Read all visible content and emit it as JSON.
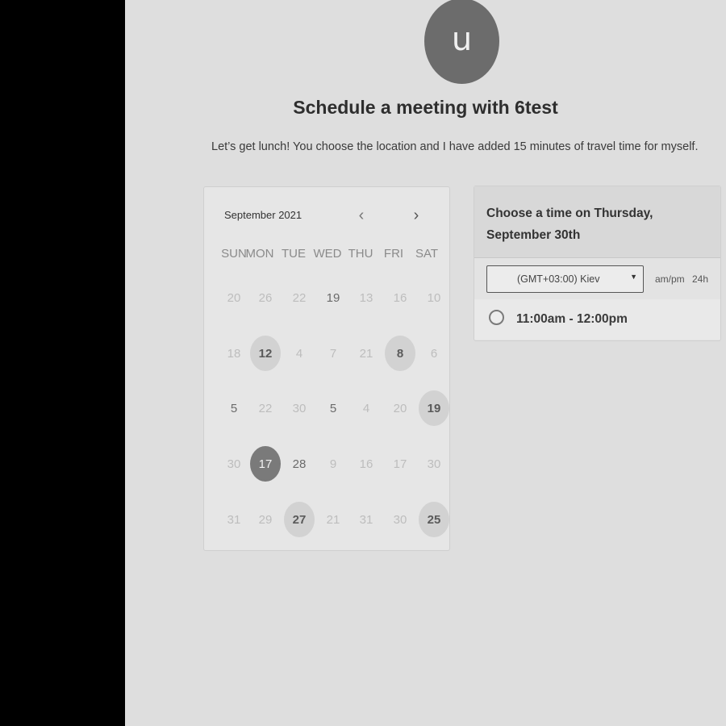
{
  "avatar": {
    "initial": "u"
  },
  "header": {
    "title": "Schedule a meeting with 6test",
    "description": "Let’s get lunch! You choose the location and I have added 15 minutes of travel time for myself."
  },
  "calendar": {
    "month_label": "September 2021",
    "prev_icon": "‹",
    "next_icon": "›",
    "weekdays": [
      "SUN",
      "MON",
      "TUE",
      "WED",
      "THU",
      "FRI",
      "SAT"
    ],
    "weeks": [
      [
        {
          "d": "20",
          "s": "muted"
        },
        {
          "d": "26",
          "s": "muted"
        },
        {
          "d": "22",
          "s": "muted"
        },
        {
          "d": "19",
          "s": "bold"
        },
        {
          "d": "13",
          "s": "muted"
        },
        {
          "d": "16",
          "s": "muted"
        },
        {
          "d": "10",
          "s": "muted"
        }
      ],
      [
        {
          "d": "18",
          "s": "muted"
        },
        {
          "d": "12",
          "s": "available"
        },
        {
          "d": "4",
          "s": "muted"
        },
        {
          "d": "7",
          "s": "muted"
        },
        {
          "d": "21",
          "s": "muted"
        },
        {
          "d": "8",
          "s": "available"
        },
        {
          "d": "6",
          "s": "muted"
        }
      ],
      [
        {
          "d": "5",
          "s": "bold"
        },
        {
          "d": "22",
          "s": "muted"
        },
        {
          "d": "30",
          "s": "muted"
        },
        {
          "d": "5",
          "s": "bold"
        },
        {
          "d": "4",
          "s": "muted"
        },
        {
          "d": "20",
          "s": "muted"
        },
        {
          "d": "19",
          "s": "available"
        }
      ],
      [
        {
          "d": "30",
          "s": "muted"
        },
        {
          "d": "17",
          "s": "selected"
        },
        {
          "d": "28",
          "s": "bold"
        },
        {
          "d": "9",
          "s": "muted"
        },
        {
          "d": "16",
          "s": "muted"
        },
        {
          "d": "17",
          "s": "muted"
        },
        {
          "d": "30",
          "s": "muted"
        }
      ],
      [
        {
          "d": "31",
          "s": "muted"
        },
        {
          "d": "29",
          "s": "muted"
        },
        {
          "d": "27",
          "s": "available"
        },
        {
          "d": "21",
          "s": "muted"
        },
        {
          "d": "31",
          "s": "muted"
        },
        {
          "d": "30",
          "s": "muted"
        },
        {
          "d": "25",
          "s": "available"
        }
      ]
    ]
  },
  "time_panel": {
    "title": "Choose a time on Thursday, September 30th",
    "timezone": "(GMT+03:00) Kiev",
    "timezone_caret": "▼",
    "format_ampm": "am/pm",
    "format_24h": "24h",
    "slots": [
      "11:00am - 12:00pm"
    ]
  }
}
